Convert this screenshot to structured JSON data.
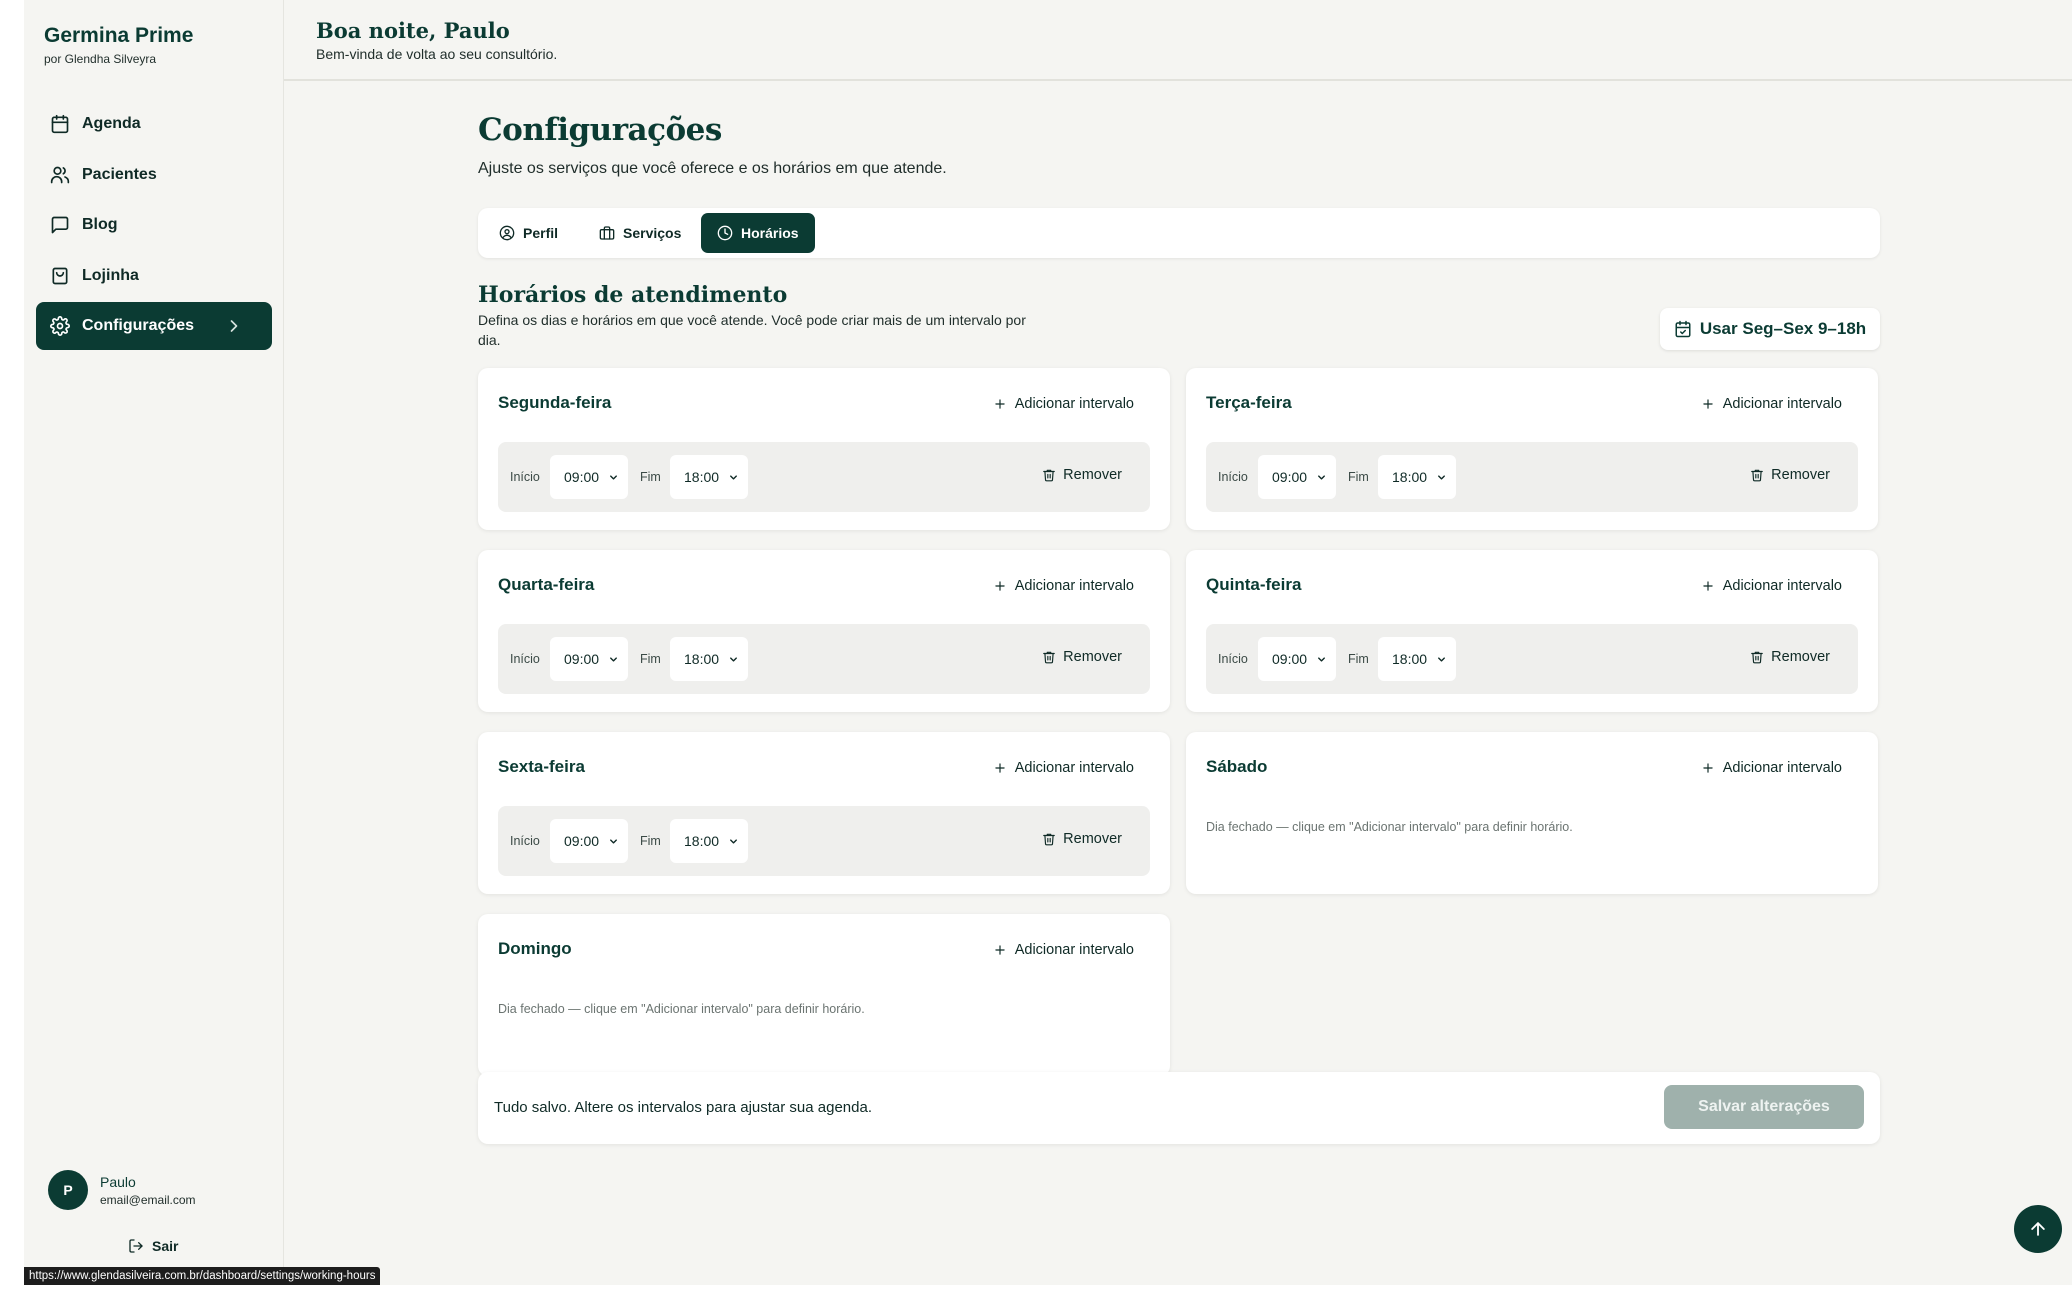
{
  "brand": {
    "title": "Germina Prime",
    "subtitle": "por Glendha Silveyra"
  },
  "sidebar": {
    "items": [
      {
        "label": "Agenda",
        "icon": "calendar-icon"
      },
      {
        "label": "Pacientes",
        "icon": "users-icon"
      },
      {
        "label": "Blog",
        "icon": "message-square-icon"
      },
      {
        "label": "Lojinha",
        "icon": "shopping-bag-icon"
      },
      {
        "label": "Configurações",
        "icon": "gear-icon",
        "active": true
      }
    ]
  },
  "user": {
    "initial": "P",
    "name": "Paulo",
    "email": "email@email.com",
    "logout_label": "Sair"
  },
  "header": {
    "greeting": "Boa noite, Paulo",
    "subtitle": "Bem-vinda de volta ao seu consultório."
  },
  "page": {
    "title": "Configurações",
    "subtitle": "Ajuste os serviços que você oferece e os horários em que atende."
  },
  "tabs": [
    {
      "label": "Perfil",
      "icon": "user-circle-icon"
    },
    {
      "label": "Serviços",
      "icon": "briefcase-icon"
    },
    {
      "label": "Horários",
      "icon": "clock-icon",
      "active": true
    }
  ],
  "hours": {
    "title": "Horários de atendimento",
    "description": "Defina os dias e horários em que você atende. Você pode criar mais de um intervalo por dia.",
    "preset_label": "Usar Seg–Sex 9–18h",
    "add_label": "Adicionar intervalo",
    "start_label": "Início",
    "end_label": "Fim",
    "remove_label": "Remover",
    "days": [
      {
        "name": "Segunda-feira",
        "start": "09:00",
        "end": "18:00"
      },
      {
        "name": "Terça-feira",
        "start": "09:00",
        "end": "18:00"
      },
      {
        "name": "Quarta-feira",
        "start": "09:00",
        "end": "18:00"
      },
      {
        "name": "Quinta-feira",
        "start": "09:00",
        "end": "18:00"
      },
      {
        "name": "Sexta-feira",
        "start": "09:00",
        "end": "18:00"
      },
      {
        "name": "Sábado",
        "closed_note": "Dia fechado — clique em \"Adicionar intervalo\" para definir horário."
      },
      {
        "name": "Domingo",
        "closed_note": "Dia fechado — clique em \"Adicionar intervalo\" para definir horário."
      }
    ]
  },
  "savebar": {
    "message": "Tudo salvo. Altere os intervalos para ajustar sua agenda.",
    "button_label": "Salvar alterações"
  },
  "status_url": "https://www.glendasilveira.com.br/dashboard/settings/working-hours",
  "colors": {
    "brand": "#0b3b33",
    "background": "#f5f5f2",
    "disabled_button": "#9fb1ac"
  }
}
